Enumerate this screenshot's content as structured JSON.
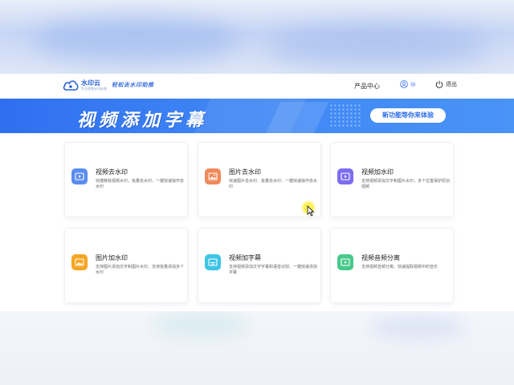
{
  "header": {
    "logo_name": "水印云",
    "logo_sub": "专注视频水印处理",
    "slogan": "轻松去水印助推",
    "nav_product": "产品中心",
    "user_name": "ip",
    "logout": "退出"
  },
  "banner": {
    "title": "视频添加字幕",
    "cta": "新功能等你来体验"
  },
  "cards": [
    {
      "title": "视频去水印",
      "desc": "快捷移除视频水印，批量去水印、一键快速操作去水印",
      "icon": "video-remove-watermark-icon",
      "color": "#5b8def"
    },
    {
      "title": "图片去水印",
      "desc": "快速图片去水印、批量去水印、一键快速操作去水印",
      "icon": "image-remove-watermark-icon",
      "color": "#f08a5d"
    },
    {
      "title": "视频加水印",
      "desc": "支持视频添加文字和图片水印，多个位置保护原创视频",
      "icon": "video-add-watermark-icon",
      "color": "#7b6cf0"
    },
    {
      "title": "图片加水印",
      "desc": "支持图片添加文字和图片水印、支持批量添加多个水印",
      "icon": "image-add-watermark-icon",
      "color": "#f5a623"
    },
    {
      "title": "视频加字幕",
      "desc": "支持视频添加文字字幕和语音识别、一键快速添加字幕",
      "icon": "video-subtitle-icon",
      "color": "#3ec5e6"
    },
    {
      "title": "视频音频分离",
      "desc": "支持视频音频分离、快速提取视频中的音乐",
      "icon": "audio-separate-icon",
      "color": "#48c98a"
    }
  ]
}
